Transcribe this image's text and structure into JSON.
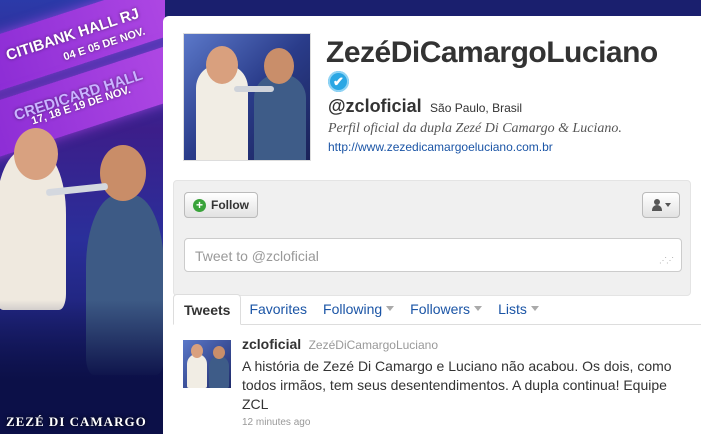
{
  "background": {
    "banner_line1": "CITIBANK HALL RJ",
    "banner_line2": "04 E 05 DE NOV.",
    "banner_line3": "CREDICARD HALL",
    "banner_line4": "17, 18 E 19 DE NOV.",
    "brand": "ZEZÉ DI CAMARGO"
  },
  "profile": {
    "fullname": "ZezéDiCamargoLuciano",
    "verified_icon": "✔",
    "screen_name": "@zcloficial",
    "location": "São Paulo, Brasil",
    "bio": "Perfil oficial da dupla Zezé Di Camargo & Luciano.",
    "url": "http://www.zezedicamargoeluciano.com.br"
  },
  "actions": {
    "follow_label": "Follow",
    "tweet_placeholder": "Tweet to @zcloficial",
    "resize_glyph": "⋰⋰"
  },
  "tabs": [
    {
      "label": "Tweets"
    },
    {
      "label": "Favorites"
    },
    {
      "label": "Following"
    },
    {
      "label": "Followers"
    },
    {
      "label": "Lists"
    }
  ],
  "tweet": {
    "username": "zcloficial",
    "name": "ZezéDiCamargoLuciano",
    "text": "A história de Zezé Di Camargo e Luciano não acabou. Os dois, como todos irmãos, tem seus desentendimentos. A dupla continua! Equipe ZCL",
    "time": "12 minutes ago"
  },
  "colors": {
    "link": "#1b55a6",
    "verified": "#2aa7e4",
    "follow_plus": "#39a33a",
    "banner_purple": "#b44ce6"
  }
}
